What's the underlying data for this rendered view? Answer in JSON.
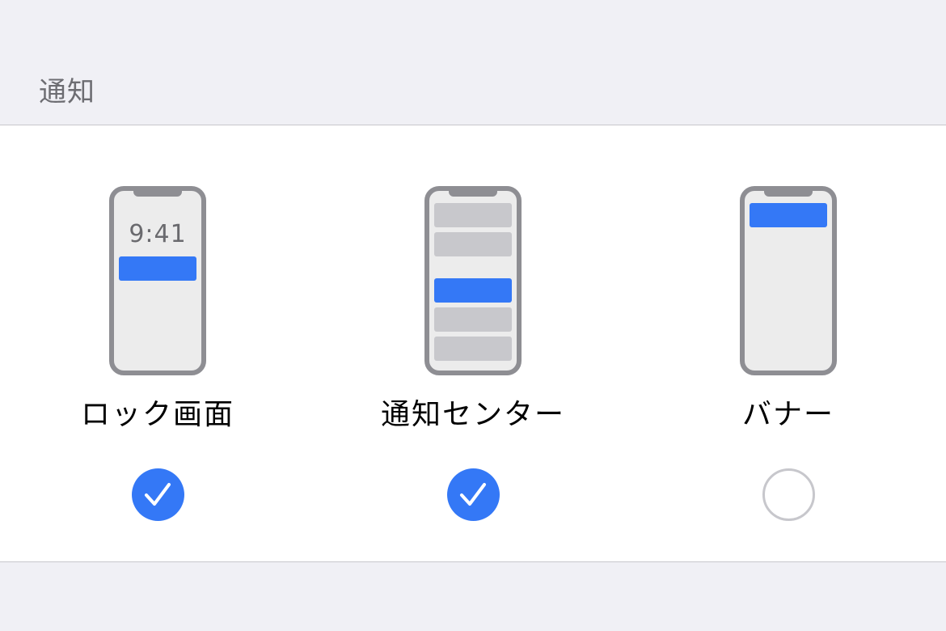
{
  "section": {
    "title": "通知"
  },
  "options": [
    {
      "label": "ロック画面",
      "checked": true,
      "preview": "lock-screen",
      "clock": "9:41"
    },
    {
      "label": "通知センター",
      "checked": true,
      "preview": "notification-center"
    },
    {
      "label": "バナー",
      "checked": false,
      "preview": "banner"
    }
  ],
  "colors": {
    "accent": "#3478f6",
    "background": "#f0f0f5",
    "card": "#ffffff",
    "phone_frame": "#8e8e93",
    "phone_screen": "#ececec",
    "placeholder": "#c8c8cc",
    "secondary_text": "#6d6d72"
  }
}
